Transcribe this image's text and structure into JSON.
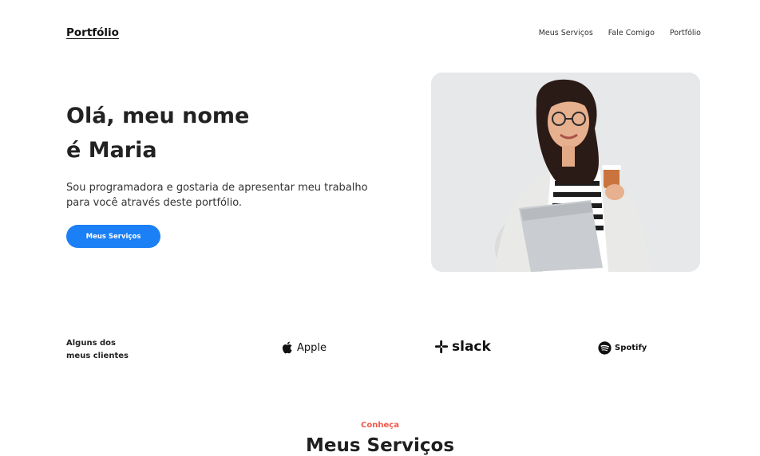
{
  "header": {
    "brand": "Portfólio",
    "nav": [
      "Meus Serviços",
      "Fale Comigo",
      "Portfólio"
    ]
  },
  "hero": {
    "title_line1": "Olá, meu nome",
    "title_line2": "é Maria",
    "text": "Sou programadora e gostaria de apresentar meu trabalho para você através deste portfólio.",
    "cta_label": "Meus Serviços"
  },
  "clients": {
    "label_line1": "Alguns dos",
    "label_line2": "meus clientes",
    "logos": [
      {
        "name": "Apple",
        "icon": "apple-icon"
      },
      {
        "name": "slack",
        "icon": "slack-icon"
      },
      {
        "name": "Spotify",
        "icon": "spotify-icon"
      }
    ]
  },
  "services": {
    "kicker": "Conheça",
    "title": "Meus Serviços"
  },
  "colors": {
    "accent": "#1b7ff5",
    "kicker": "#f0574a",
    "text": "#1f1f1f"
  }
}
